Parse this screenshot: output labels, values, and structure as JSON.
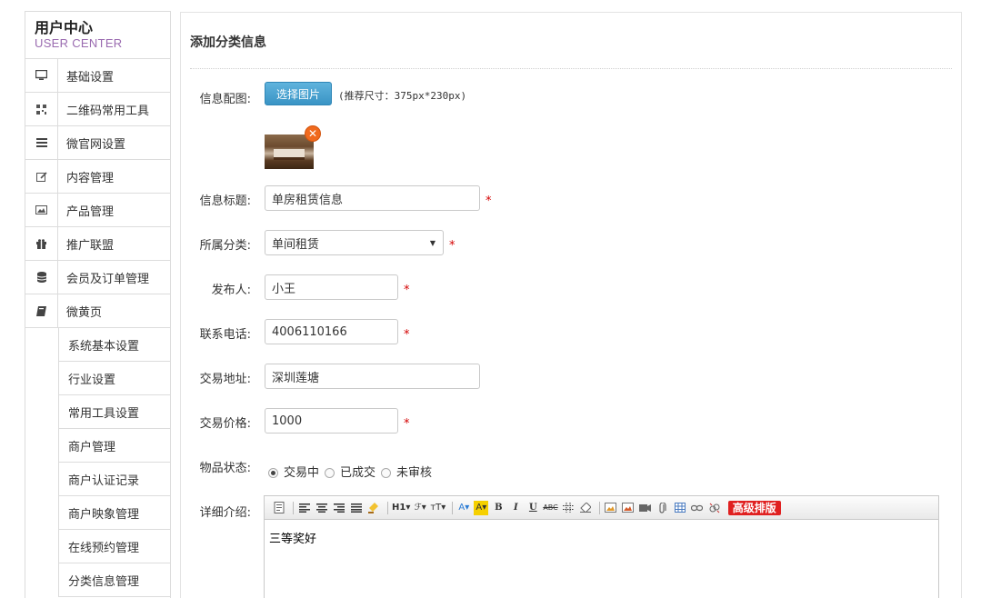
{
  "brand": {
    "title_cn": "用户中心",
    "title_en": "USER CENTER"
  },
  "nav": [
    {
      "label": "基础设置",
      "icon": "monitor-icon"
    },
    {
      "label": "二维码常用工具",
      "icon": "qrcode-icon"
    },
    {
      "label": "微官网设置",
      "icon": "list-icon"
    },
    {
      "label": "内容管理",
      "icon": "edit-icon"
    },
    {
      "label": "产品管理",
      "icon": "picture-icon"
    },
    {
      "label": "推广联盟",
      "icon": "gift-icon"
    },
    {
      "label": "会员及订单管理",
      "icon": "database-icon"
    },
    {
      "label": "微黄页",
      "icon": "book-icon"
    }
  ],
  "subnav": [
    "系统基本设置",
    "行业设置",
    "常用工具设置",
    "商户管理",
    "商户认证记录",
    "商户映象管理",
    "在线预约管理",
    "分类信息管理"
  ],
  "form": {
    "page_title": "添加分类信息",
    "image_label": "信息配图:",
    "upload_button": "选择图片",
    "upload_hint": "(推荐尺寸：375px*230px)",
    "title_label": "信息标题:",
    "title_value": "单房租赁信息",
    "category_label": "所属分类:",
    "category_value": "单间租赁",
    "publisher_label": "发布人:",
    "publisher_value": "小王",
    "phone_label": "联系电话:",
    "phone_value": "4006110166",
    "address_label": "交易地址:",
    "address_value": "深圳莲塘",
    "price_label": "交易价格:",
    "price_value": "1000",
    "status_label": "物品状态:",
    "status_options": [
      "交易中",
      "已成交",
      "未审核"
    ],
    "status_selected": 0,
    "detail_label": "详细介绍:",
    "detail_value": "三等奖好",
    "required_mark": "*",
    "advanced_button": "高级排版"
  }
}
